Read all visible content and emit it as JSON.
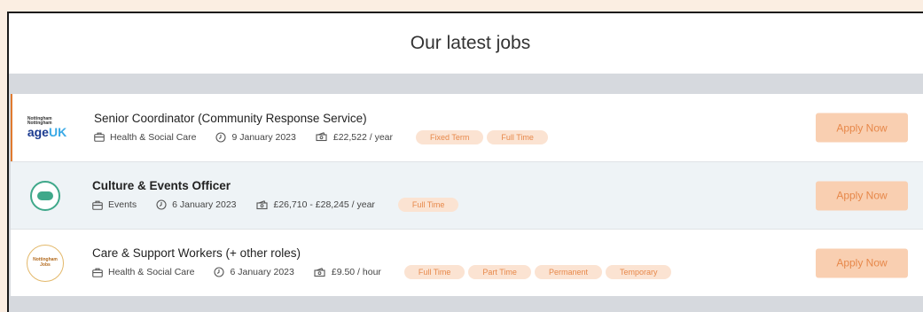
{
  "header": {
    "title": "Our latest jobs"
  },
  "jobs": [
    {
      "title": "Senior Coordinator (Community Response Service)",
      "category": "Health & Social Care",
      "date": "9 January 2023",
      "salary": "£22,522 / year",
      "tags": [
        "Fixed Term",
        "Full Time"
      ],
      "apply_label": "Apply Now",
      "logo": {
        "line1": "Nottingham",
        "line2": "Nottingham",
        "brand": "age",
        "brand2": "UK"
      }
    },
    {
      "title": "Culture & Events Officer",
      "category": "Events",
      "date": "6 January 2023",
      "salary": "£26,710 - £28,245 / year",
      "tags": [
        "Full Time"
      ],
      "apply_label": "Apply Now"
    },
    {
      "title": "Care & Support Workers (+ other roles)",
      "category": "Health & Social Care",
      "date": "6 January 2023",
      "salary": "£9.50 / hour",
      "tags": [
        "Full Time",
        "Part Time",
        "Permanent",
        "Temporary"
      ],
      "apply_label": "Apply Now",
      "logo": {
        "line1": "Nottingham",
        "line2": "Jobs"
      }
    }
  ],
  "colors": {
    "accent": "#e7884a",
    "tag_bg": "#fbe3d2",
    "button_bg": "#f9cfb1",
    "list_bg": "#d6d9de"
  }
}
